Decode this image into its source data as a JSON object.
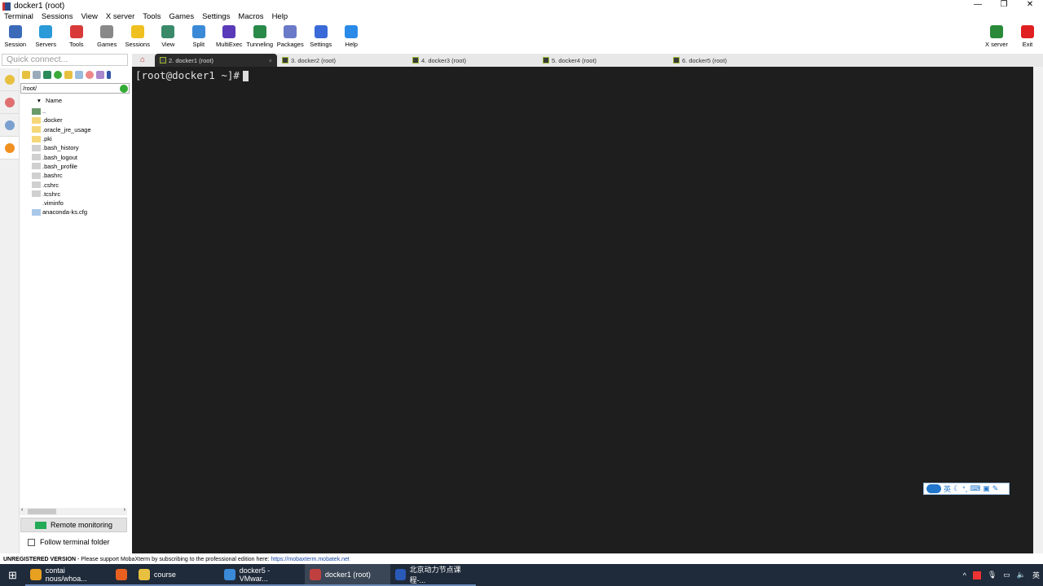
{
  "window": {
    "title": "docker1 (root)"
  },
  "menu": [
    "Terminal",
    "Sessions",
    "View",
    "X server",
    "Tools",
    "Games",
    "Settings",
    "Macros",
    "Help"
  ],
  "toolbar": [
    {
      "label": "Session",
      "icon": "session-icon",
      "color": "#3a6ab8"
    },
    {
      "label": "Servers",
      "icon": "servers-icon",
      "color": "#2a9ad8"
    },
    {
      "label": "Tools",
      "icon": "tools-icon",
      "color": "#d83a3a"
    },
    {
      "label": "Games",
      "icon": "games-icon",
      "color": "#888888"
    },
    {
      "label": "Sessions",
      "icon": "star-icon",
      "color": "#f0c020"
    },
    {
      "label": "View",
      "icon": "view-icon",
      "color": "#3a8a6a"
    },
    {
      "label": "Split",
      "icon": "split-icon",
      "color": "#3a8ad8"
    },
    {
      "label": "MultiExec",
      "icon": "multiexec-icon",
      "color": "#5a3ab8"
    },
    {
      "label": "Tunneling",
      "icon": "tunneling-icon",
      "color": "#2a8a4a"
    },
    {
      "label": "Packages",
      "icon": "packages-icon",
      "color": "#6a7ac8"
    },
    {
      "label": "Settings",
      "icon": "gear-icon",
      "color": "#3a6ad8"
    },
    {
      "label": "Help",
      "icon": "help-icon",
      "color": "#2a8ae8"
    }
  ],
  "right_buttons": [
    {
      "label": "X server",
      "icon": "x-server-icon",
      "color": "#2a8a3a"
    },
    {
      "label": "Exit",
      "icon": "power-icon",
      "color": "#e02020"
    }
  ],
  "quick_connect": {
    "placeholder": "Quick connect..."
  },
  "tabs": [
    {
      "label": "2. docker1 (root)",
      "active": true
    },
    {
      "label": "3. docker2 (root)"
    },
    {
      "label": "4. docker3 (root)"
    },
    {
      "label": "5. docker4 (root)"
    },
    {
      "label": "6. docker5 (root)"
    }
  ],
  "terminal": {
    "prompt": "[root@docker1 ~]#"
  },
  "sftp": {
    "path": "/root/",
    "column": "Name",
    "files": [
      {
        "name": "..",
        "type": "up"
      },
      {
        "name": ".docker",
        "type": "folder"
      },
      {
        "name": ".oracle_jre_usage",
        "type": "folder"
      },
      {
        "name": ".pki",
        "type": "folder"
      },
      {
        "name": ".bash_history",
        "type": "file"
      },
      {
        "name": ".bash_logout",
        "type": "file"
      },
      {
        "name": ".bash_profile",
        "type": "file"
      },
      {
        "name": ".bashrc",
        "type": "file"
      },
      {
        "name": ".cshrc",
        "type": "file"
      },
      {
        "name": ".tcshrc",
        "type": "file"
      },
      {
        "name": ".viminfo",
        "type": "blank"
      },
      {
        "name": "anaconda-ks.cfg",
        "type": "cfg"
      }
    ],
    "remote_monitoring": "Remote monitoring",
    "follow_folder": "Follow terminal folder",
    "follow_checked": false
  },
  "status": {
    "label": "UNREGISTERED VERSION",
    "text": "  -  Please support MobaXterm by subscribing to the professional edition here:  ",
    "link": "https://mobaxterm.mobatek.net"
  },
  "ime": {
    "lang": "英"
  },
  "taskbar": [
    {
      "label": "contai​nous/whoa...",
      "icon": "chrome-icon",
      "color": "#e8a020"
    },
    {
      "label": "",
      "icon": "firefox-icon",
      "color": "#e86020"
    },
    {
      "label": "course",
      "icon": "folder-icon",
      "color": "#e8c040"
    },
    {
      "label": "docker5 - VMwar...",
      "icon": "vmware-icon",
      "color": "#3a8ad8"
    },
    {
      "label": "docker1 (root)",
      "icon": "mobaxterm-icon",
      "color": "#c04040",
      "active": true
    },
    {
      "label": "北京动力节点课程-...",
      "icon": "word-icon",
      "color": "#2a5ab8"
    }
  ],
  "tray": {
    "lang": "英"
  }
}
